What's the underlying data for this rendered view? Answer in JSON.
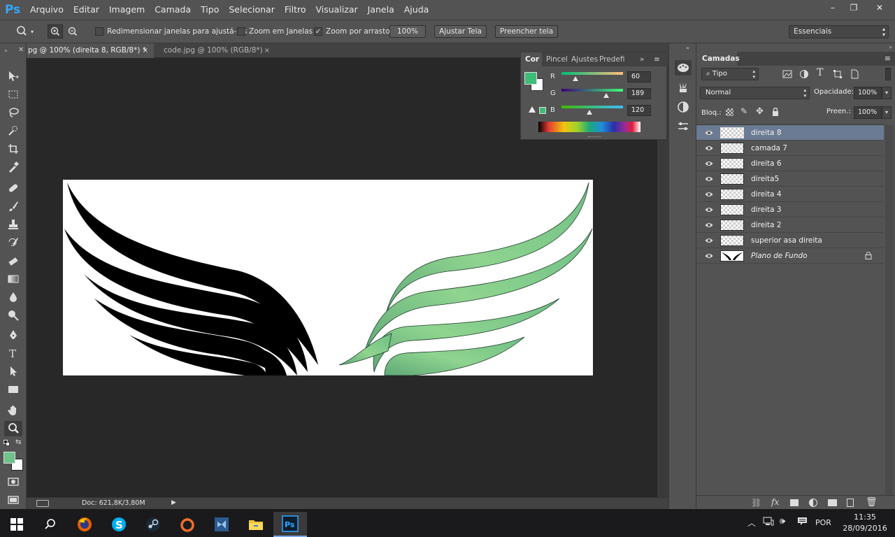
{
  "app": {
    "logo_text": "Ps",
    "menu": [
      "Arquivo",
      "Editar",
      "Imagem",
      "Camada",
      "Tipo",
      "Selecionar",
      "Filtro",
      "Visualizar",
      "Janela",
      "Ajuda"
    ],
    "window_controls": {
      "minimize": "–",
      "restore": "❐",
      "close": "✕"
    }
  },
  "options_bar": {
    "resize_windows_label": "Redimensionar janelas para ajustá-las",
    "zoom_windows_label": "Zoom em Janelas",
    "scrubby_zoom_label": "Zoom por arrasto",
    "scrubby_zoom_checked": true,
    "btn_100": "100%",
    "btn_fit": "Ajustar Tela",
    "btn_fill": "Preencher tela",
    "workspace": "Essenciais"
  },
  "documents": {
    "active_tab": "pg @ 100% (direita 8, RGB/8*) *",
    "inactive_tab": "code.jpg @ 100% (RGB/8*)",
    "close_symbol": "×"
  },
  "status": {
    "doc_info": "Doc: 621,8K/3,80M"
  },
  "color_panel": {
    "tabs": [
      "Cor",
      "Pincel",
      "Ajustes",
      "Predefi"
    ],
    "foreground": "#3cbd78",
    "channels": [
      {
        "label": "R",
        "value": "60"
      },
      {
        "label": "G",
        "value": "189"
      },
      {
        "label": "B",
        "value": "120"
      }
    ]
  },
  "layers_panel": {
    "title": "Camadas",
    "filter_kind": "Tipo",
    "blend_mode": "Normal",
    "opacity_label": "Opacidade:",
    "opacity_value": "100%",
    "lock_label": "Bloq.:",
    "fill_label": "Preen.:",
    "fill_value": "100%",
    "layers": [
      {
        "name": "direita 8",
        "selected": true
      },
      {
        "name": "camada 7",
        "selected": false
      },
      {
        "name": "direita 6",
        "selected": false
      },
      {
        "name": "direita5",
        "selected": false
      },
      {
        "name": "direita 4",
        "selected": false
      },
      {
        "name": "direita 3",
        "selected": false
      },
      {
        "name": "direita 2",
        "selected": false
      },
      {
        "name": "superior asa direita",
        "selected": false
      },
      {
        "name": "Plano de Fundo",
        "selected": false,
        "italic": true,
        "locked": true
      }
    ]
  },
  "toolbar": {
    "foreground": "#6ec28a",
    "background": "#ffffff"
  },
  "taskbar": {
    "language": "POR",
    "time": "11:35",
    "date": "28/09/2016"
  }
}
